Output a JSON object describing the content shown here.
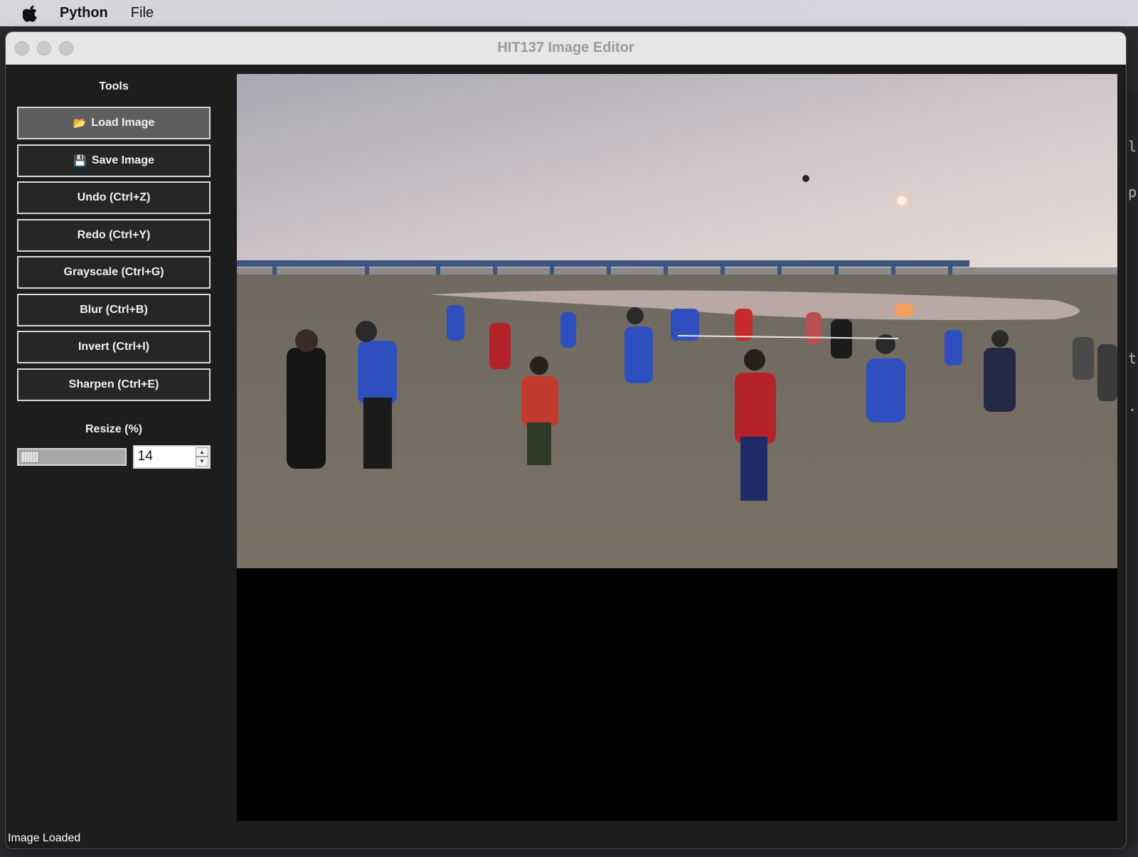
{
  "menubar": {
    "app_name": "Python",
    "menus": [
      "File"
    ]
  },
  "window": {
    "title": "HIT137 Image Editor"
  },
  "sidebar": {
    "title": "Tools",
    "buttons": [
      {
        "label": "Load Image",
        "icon": "folder-icon",
        "glyph": "📂"
      },
      {
        "label": "Save Image",
        "icon": "floppy-disk-icon",
        "glyph": "💾"
      },
      {
        "label": "Undo (Ctrl+Z)"
      },
      {
        "label": "Redo (Ctrl+Y)"
      },
      {
        "label": "Grayscale (Ctrl+G)"
      },
      {
        "label": "Blur (Ctrl+B)"
      },
      {
        "label": "Invert (Ctrl+I)"
      },
      {
        "label": "Sharpen (Ctrl+E)"
      }
    ],
    "resize": {
      "label": "Resize (%)",
      "value": "14"
    }
  },
  "status": {
    "text": "Image Loaded"
  },
  "backdrop": {
    "fragments": [
      "t l",
      "e.p",
      "t",
      ")."
    ]
  },
  "colors": {
    "sky_top": "#b9b8be",
    "sky_glow": "#e8dcd6",
    "sand": "#6e665c",
    "blue_shirts": "#2f4fbf",
    "red_shirts": "#b5232a"
  }
}
